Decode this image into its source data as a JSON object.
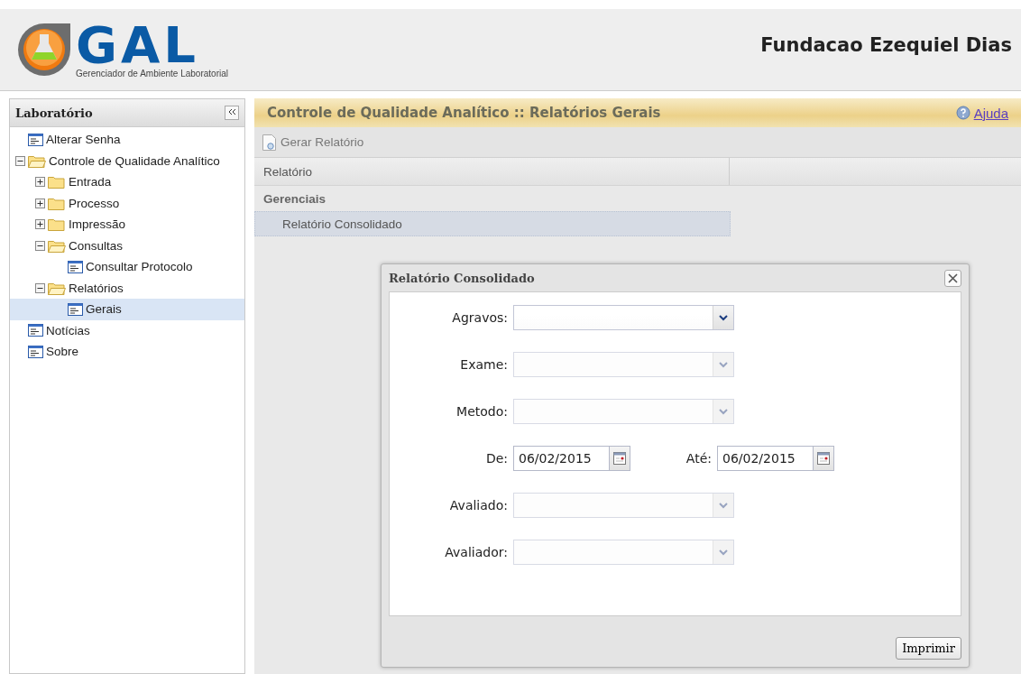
{
  "header": {
    "logo_text": "GAL",
    "logo_subtitle": "Gerenciador de Ambiente Laboratorial",
    "organization": "Fundacao Ezequiel Dias"
  },
  "sidebar": {
    "title": "Laboratório",
    "items": [
      {
        "kind": "page",
        "label": "Alterar Senha",
        "selected": false
      },
      {
        "kind": "folder",
        "label": "Controle de Qualidade Analítico",
        "expanded": true,
        "selected": false,
        "children": [
          {
            "kind": "folder",
            "label": "Entrada",
            "expanded": false,
            "selected": false
          },
          {
            "kind": "folder",
            "label": "Processo",
            "expanded": false,
            "selected": false
          },
          {
            "kind": "folder",
            "label": "Impressão",
            "expanded": false,
            "selected": false
          },
          {
            "kind": "folder",
            "label": "Consultas",
            "expanded": true,
            "selected": false,
            "children": [
              {
                "kind": "page",
                "label": "Consultar Protocolo",
                "selected": false
              }
            ]
          },
          {
            "kind": "folder",
            "label": "Relatórios",
            "expanded": true,
            "selected": false,
            "children": [
              {
                "kind": "page",
                "label": "Gerais",
                "selected": true
              }
            ]
          }
        ]
      },
      {
        "kind": "page",
        "label": "Notícias",
        "selected": false
      },
      {
        "kind": "page",
        "label": "Sobre",
        "selected": false
      }
    ]
  },
  "main": {
    "title": "Controle de Qualidade Analítico :: Relatórios Gerais",
    "help_link": "Ajuda",
    "toolbar_button": "Gerar Relatório",
    "grid": {
      "column": "Relatório",
      "group": "Gerenciais",
      "rows": [
        {
          "label": "Relatório Consolidado",
          "selected": true
        }
      ]
    }
  },
  "dialog": {
    "title": "Relatório Consolidado",
    "rows": [
      {
        "kind": "combo",
        "label": "Agravos:",
        "disabled": false
      },
      {
        "kind": "combo",
        "label": "Exame:",
        "disabled": true
      },
      {
        "kind": "combo",
        "label": "Metodo:",
        "disabled": true
      },
      {
        "kind": "dates",
        "fields": [
          {
            "label": "De:",
            "value": "06/02/2015"
          },
          {
            "label": "Até:",
            "value": "06/02/2015"
          }
        ]
      },
      {
        "kind": "combo",
        "label": "Avaliado:",
        "disabled": true
      },
      {
        "kind": "combo",
        "label": "Avaliador:",
        "disabled": true
      }
    ],
    "button": "Imprimir"
  }
}
